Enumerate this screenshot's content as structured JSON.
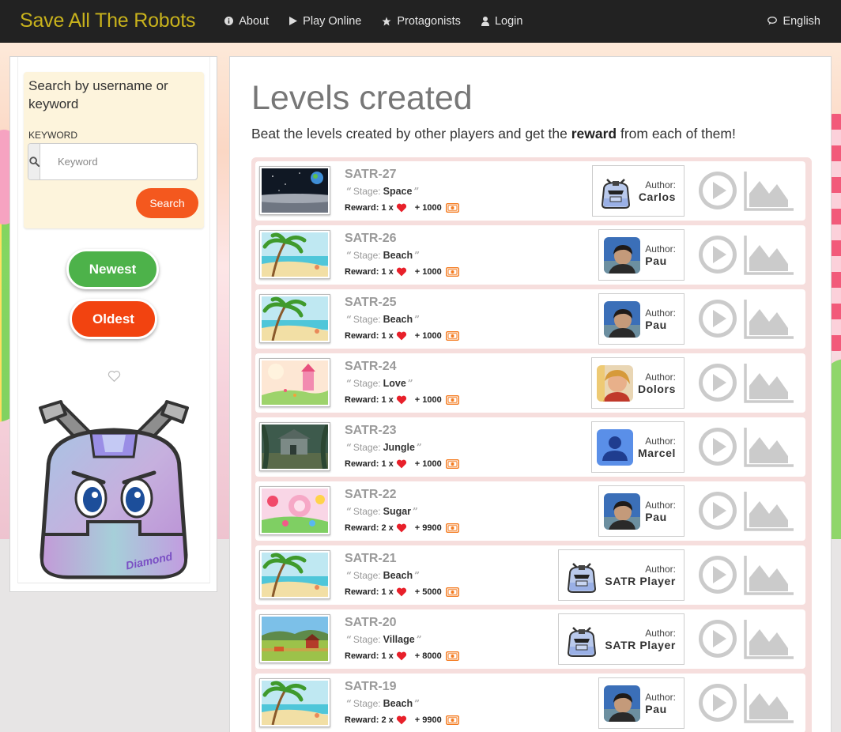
{
  "navbar": {
    "brand": "Save All The Robots",
    "links": [
      {
        "label": "About",
        "icon": "info-icon"
      },
      {
        "label": "Play Online",
        "icon": "play-icon"
      },
      {
        "label": "Protagonists",
        "icon": "star-icon"
      },
      {
        "label": "Login",
        "icon": "user-icon"
      }
    ],
    "language": {
      "label": "English",
      "icon": "chat-icon"
    }
  },
  "sidebar": {
    "search_title": "Search by username or keyword",
    "keyword_label": "KEYWORD",
    "keyword_placeholder": "Keyword",
    "keyword_value": "",
    "search_button": "Search",
    "newest_button": "Newest",
    "oldest_button": "Oldest",
    "mascot_label": "Diamond"
  },
  "main": {
    "title": "Levels created",
    "intro_before": "Beat the levels created by other players and get the ",
    "intro_bold": "reward",
    "intro_after": " from each of them!",
    "stage_label": "Stage:",
    "reward_label": "Reward:",
    "author_label": "Author:",
    "levels": [
      {
        "code": "SATR-27",
        "stage": "Space",
        "hearts": "1 x",
        "coins": "+ 1000",
        "author": "Carlos",
        "avatar": "robot",
        "thumb": "space"
      },
      {
        "code": "SATR-26",
        "stage": "Beach",
        "hearts": "1 x",
        "coins": "+ 1000",
        "author": "Pau",
        "avatar": "photo-dark",
        "thumb": "beach"
      },
      {
        "code": "SATR-25",
        "stage": "Beach",
        "hearts": "1 x",
        "coins": "+ 1000",
        "author": "Pau",
        "avatar": "photo-dark",
        "thumb": "beach"
      },
      {
        "code": "SATR-24",
        "stage": "Love",
        "hearts": "1 x",
        "coins": "+ 1000",
        "author": "Dolors",
        "avatar": "photo-light",
        "thumb": "love"
      },
      {
        "code": "SATR-23",
        "stage": "Jungle",
        "hearts": "1 x",
        "coins": "+ 1000",
        "author": "Marcel",
        "avatar": "generic",
        "thumb": "jungle"
      },
      {
        "code": "SATR-22",
        "stage": "Sugar",
        "hearts": "2 x",
        "coins": "+ 9900",
        "author": "Pau",
        "avatar": "photo-dark",
        "thumb": "sugar"
      },
      {
        "code": "SATR-21",
        "stage": "Beach",
        "hearts": "1 x",
        "coins": "+ 5000",
        "author": "SATR Player",
        "avatar": "robot",
        "thumb": "beach"
      },
      {
        "code": "SATR-20",
        "stage": "Village",
        "hearts": "1 x",
        "coins": "+ 8000",
        "author": "SATR Player",
        "avatar": "robot",
        "thumb": "village"
      },
      {
        "code": "SATR-19",
        "stage": "Beach",
        "hearts": "2 x",
        "coins": "+ 9900",
        "author": "Pau",
        "avatar": "photo-dark",
        "thumb": "beach"
      }
    ]
  },
  "colors": {
    "brand": "#c8b21c",
    "navbar_bg": "#222222",
    "search_button": "#f4581e",
    "newest_button": "#4db24a",
    "oldest_button": "#f24310",
    "heart": "#e8202a",
    "coin": "#f47b20",
    "level_frame": "#f6dedd"
  }
}
